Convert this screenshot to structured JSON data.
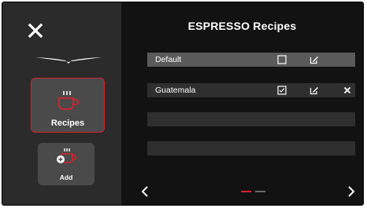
{
  "header": {
    "title": "ESPRESSO Recipes"
  },
  "sidebar": {
    "tiles": [
      {
        "label": "Recipes",
        "icon": "recipes-cup-icon"
      },
      {
        "label": "Add",
        "icon": "add-cup-icon"
      }
    ]
  },
  "recipes": {
    "rows": [
      {
        "label": "Default",
        "selected": true,
        "checked": false
      },
      {
        "label": "Guatemala",
        "selected": false,
        "checked": true
      },
      {
        "label": ""
      },
      {
        "label": ""
      }
    ]
  },
  "pager": {
    "current_page": 1,
    "total_pages": 2
  },
  "colors": {
    "accent": "#d8222c",
    "background": "#121212",
    "sidebar": "#2b2b2b",
    "tile": "#4a4a4a",
    "row": "#2f2f2f",
    "row_selected": "#5a5a5a"
  }
}
